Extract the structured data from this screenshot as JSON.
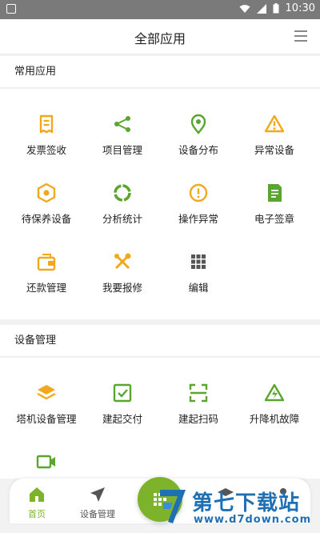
{
  "status_bar": {
    "time": "10:30"
  },
  "header": {
    "title": "全部应用"
  },
  "sections": [
    {
      "title": "常用应用",
      "items": [
        {
          "label": "发票签收",
          "icon": "invoice-icon"
        },
        {
          "label": "项目管理",
          "icon": "share-nodes-icon"
        },
        {
          "label": "设备分布",
          "icon": "location-pin-icon"
        },
        {
          "label": "异常设备",
          "icon": "warning-triangle-icon"
        },
        {
          "label": "待保养设备",
          "icon": "hexagon-nut-icon"
        },
        {
          "label": "分析统计",
          "icon": "donut-chart-icon"
        },
        {
          "label": "操作异常",
          "icon": "exclamation-circle-icon"
        },
        {
          "label": "电子签章",
          "icon": "document-icon"
        },
        {
          "label": "还款管理",
          "icon": "wallet-icon"
        },
        {
          "label": "我要报修",
          "icon": "tools-icon"
        },
        {
          "label": "编辑",
          "icon": "grid-dots-icon"
        }
      ]
    },
    {
      "title": "设备管理",
      "items": [
        {
          "label": "塔机设备管理",
          "icon": "layers-icon"
        },
        {
          "label": "建起交付",
          "icon": "checkbox-icon"
        },
        {
          "label": "建起扫码",
          "icon": "scan-icon"
        },
        {
          "label": "升降机故障",
          "icon": "lightning-triangle-icon"
        },
        {
          "label": "",
          "icon": "video-camera-icon"
        }
      ]
    }
  ],
  "bottom_nav": {
    "items": [
      {
        "label": "首页",
        "icon": "home-icon"
      },
      {
        "label": "设备管理",
        "icon": "send-icon"
      },
      {
        "label": "",
        "icon": "layers-icon"
      },
      {
        "label": "",
        "icon": "person-icon"
      }
    ]
  },
  "watermark": {
    "title": "第七下载站",
    "url": "www.d7down.com"
  },
  "colors": {
    "accent_green": "#7cb32b",
    "icon_orange": "#f2a81d",
    "icon_green": "#5aa52f",
    "watermark_blue": "#1f6fb5"
  }
}
